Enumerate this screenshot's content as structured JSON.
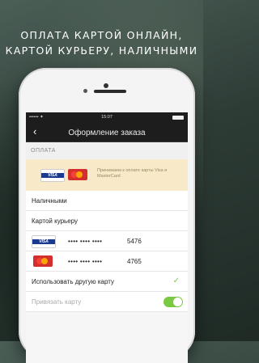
{
  "headline": {
    "line1": "ОПЛАТА КАРТОЙ ОНЛАЙН,",
    "line2": "КАРТОЙ КУРЬЕРУ, НАЛИЧНЫМИ"
  },
  "status_bar": {
    "signal": "•••••• ✦",
    "time": "15:07"
  },
  "nav": {
    "back_icon": "‹",
    "title": "Оформление заказа"
  },
  "section": {
    "label": "ОПЛАТА"
  },
  "promo": {
    "text": "Принимаем к оплате карты Visa и MasterCard",
    "visa_label": "VISA"
  },
  "payment_options": [
    {
      "label": "Наличными"
    },
    {
      "label": "Картой курьеру"
    }
  ],
  "cards": [
    {
      "type": "VISA",
      "mask": "•••• •••• ••••",
      "last4": "5476"
    },
    {
      "type": "MasterCard",
      "mask": "•••• •••• ••••",
      "last4": "4765"
    }
  ],
  "other_card": {
    "label": "Использовать другую карту",
    "selected": true,
    "check_icon": "✓"
  },
  "bind_card": {
    "label": "Привязать карту",
    "enabled": true
  },
  "colors": {
    "accent": "#7ac943",
    "promo_bg": "#f8e9c8",
    "nav_bg": "#1d1d1d"
  }
}
